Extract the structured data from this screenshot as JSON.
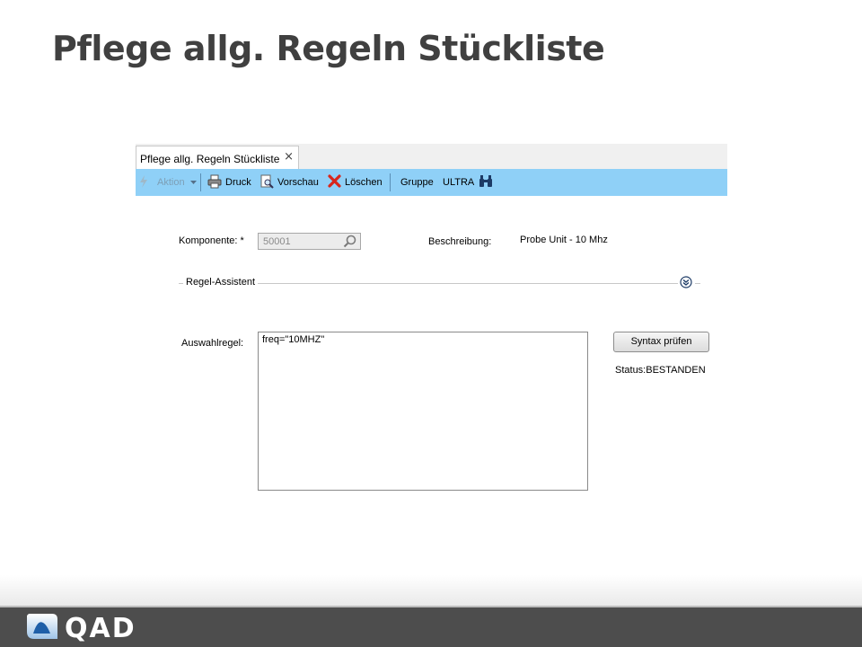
{
  "slide": {
    "title": "Pflege allg. Regeln Stückliste"
  },
  "tab": {
    "label": "Pflege allg. Regeln Stückliste",
    "close": "×"
  },
  "toolbar": {
    "aktion": "Aktion",
    "druck": "Druck",
    "vorschau": "Vorschau",
    "loeschen": "Löschen",
    "gruppe": "Gruppe",
    "ultra": "ULTRA"
  },
  "form": {
    "komponente_label": "Komponente: *",
    "komponente_value": "50001",
    "beschreibung_label": "Beschreibung:",
    "beschreibung_value": "Probe Unit - 10 Mhz",
    "section_label": "Regel-Assistent",
    "auswahlregel_label": "Auswahlregel:",
    "auswahlregel_value": "freq=\"10MHZ\"",
    "syntax_button": "Syntax prüfen",
    "status": "Status:BESTANDEN"
  },
  "footer": {
    "logo_text": "QAD"
  },
  "colors": {
    "toolbar": "#8fd0f7",
    "title": "#404040",
    "footer": "#4d4d4d"
  }
}
